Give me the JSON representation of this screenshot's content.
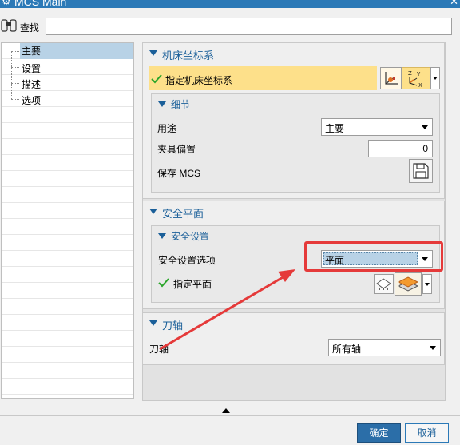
{
  "window": {
    "title": "MCS Main"
  },
  "search": {
    "label": "查找",
    "value": ""
  },
  "tree": {
    "items": [
      "主要",
      "设置",
      "描述",
      "选项"
    ],
    "selected": 0
  },
  "mcs": {
    "header": "机床坐标系",
    "specify_label": "指定机床坐标系",
    "details_header": "细节",
    "purpose_label": "用途",
    "purpose_value": "主要",
    "fixture_label": "夹具偏置",
    "fixture_value": "0",
    "save_label": "保存 MCS"
  },
  "safe_plane": {
    "header": "安全平面",
    "settings_header": "安全设置",
    "option_label": "安全设置选项",
    "option_value": "平面",
    "specify_plane_label": "指定平面"
  },
  "tool_axis": {
    "header": "刀轴",
    "label": "刀轴",
    "value": "所有轴"
  },
  "buttons": {
    "ok": "确定",
    "cancel": "取消"
  },
  "colors": {
    "accent": "#1a5f99",
    "title_bar": "#2b79b7",
    "highlight": "#e53a3a",
    "selected_bar": "#fde08a",
    "check": "#2aa52a"
  },
  "icons": [
    "gear-icon",
    "close-icon",
    "binoculars-icon",
    "csys-icon",
    "csys-dropdown-icon",
    "save-icon",
    "point-plane-icon",
    "plane-icon",
    "collapse-icon",
    "checkmark-icon"
  ]
}
